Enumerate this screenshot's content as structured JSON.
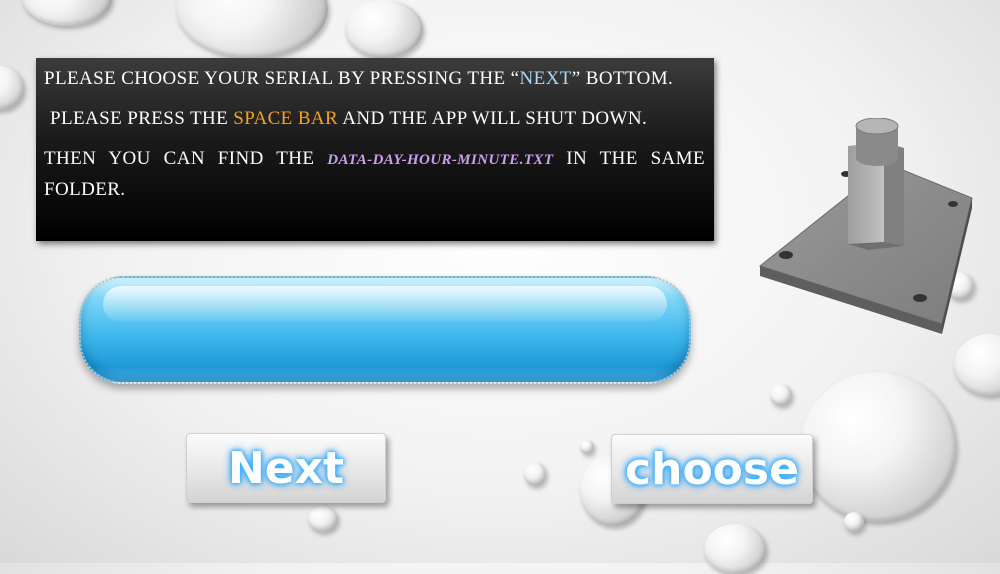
{
  "instructions": {
    "line1_pre": "PLEASE CHOOSE YOUR SERIAL BY PRESSING THE “",
    "line1_highlight": "NEXT",
    "line1_post": "” BOTTOM.",
    "line2_pre": "PLEASE PRESS THE ",
    "line2_highlight": "SPACE BAR",
    "line2_post": " AND THE APP WILL SHUT DOWN.",
    "line3_pre": "THEN YOU CAN FIND THE ",
    "line3_highlight": "DATA-DAY-HOUR-MINUTE.TXT",
    "line3_post": " IN THE SAME FOLDER."
  },
  "serial_display": {
    "value": ""
  },
  "buttons": {
    "next_label": "Next",
    "choose_label": "choose"
  },
  "colors": {
    "next_highlight": "#a9d7f5",
    "space_highlight": "#f3a31d",
    "file_highlight": "#c9a0f0",
    "button_glow": "#33b3ff"
  },
  "icons": {
    "decor_drops": "water-drop-icon",
    "stand": "metal-stand-icon"
  }
}
